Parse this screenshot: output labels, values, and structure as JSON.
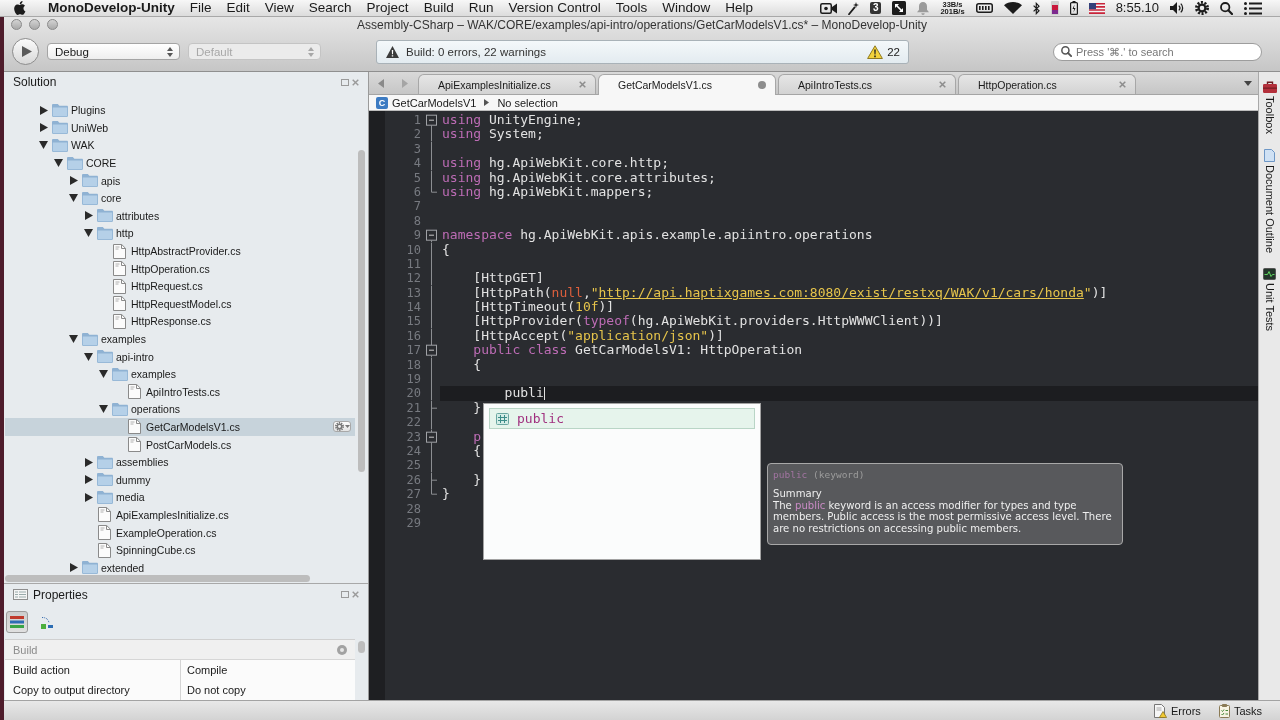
{
  "menu_bar": {
    "app_name": "MonoDevelop-Unity",
    "menus": [
      "File",
      "Edit",
      "View",
      "Search",
      "Project",
      "Build",
      "Run",
      "Version Control",
      "Tools",
      "Window",
      "Help"
    ],
    "extras_count": "3",
    "network_rates": [
      "33B/s",
      "201B/s"
    ],
    "clock": "8:55.10"
  },
  "window": {
    "title": "Assembly-CSharp – WAK/CORE/examples/api-intro/operations/GetCarModelsV1.cs* – MonoDevelop-Unity"
  },
  "toolbar": {
    "configuration": {
      "value": "Debug",
      "disabled": false
    },
    "platform": {
      "value": "Default",
      "disabled": true
    },
    "build_status": "Build: 0 errors, 22 warnings",
    "warning_count": "22",
    "search": {
      "placeholder": "Press '⌘.' to search"
    }
  },
  "solution_pad": {
    "title": "Solution",
    "tree": [
      {
        "kind": "folder",
        "label": "Plugins",
        "expanded": false,
        "selected": false
      },
      {
        "kind": "folder",
        "label": "UniWeb",
        "expanded": false,
        "selected": false
      },
      {
        "kind": "folder",
        "label": "WAK",
        "expanded": true,
        "selected": false,
        "children": [
          {
            "kind": "folder",
            "label": "CORE",
            "expanded": true,
            "selected": false,
            "children": [
              {
                "kind": "folder",
                "label": "apis",
                "expanded": false,
                "selected": false
              },
              {
                "kind": "folder",
                "label": "core",
                "expanded": true,
                "selected": false,
                "children": [
                  {
                    "kind": "folder",
                    "label": "attributes",
                    "expanded": false,
                    "selected": false
                  },
                  {
                    "kind": "folder",
                    "label": "http",
                    "expanded": true,
                    "selected": false,
                    "children": [
                      {
                        "kind": "file",
                        "label": "HttpAbstractProvider.cs",
                        "selected": false
                      },
                      {
                        "kind": "file",
                        "label": "HttpOperation.cs",
                        "selected": false
                      },
                      {
                        "kind": "file",
                        "label": "HttpRequest.cs",
                        "selected": false
                      },
                      {
                        "kind": "file",
                        "label": "HttpRequestModel.cs",
                        "selected": false
                      },
                      {
                        "kind": "file",
                        "label": "HttpResponse.cs",
                        "selected": false
                      }
                    ]
                  }
                ]
              },
              {
                "kind": "folder",
                "label": "examples",
                "expanded": true,
                "selected": false,
                "children": [
                  {
                    "kind": "folder",
                    "label": "api-intro",
                    "expanded": true,
                    "selected": false,
                    "children": [
                      {
                        "kind": "folder",
                        "label": "examples",
                        "expanded": true,
                        "selected": false,
                        "children": [
                          {
                            "kind": "file",
                            "label": "ApiIntroTests.cs",
                            "selected": false
                          }
                        ]
                      },
                      {
                        "kind": "folder",
                        "label": "operations",
                        "expanded": true,
                        "selected": false,
                        "children": [
                          {
                            "kind": "file",
                            "label": "GetCarModelsV1.cs",
                            "selected": true
                          },
                          {
                            "kind": "file",
                            "label": "PostCarModels.cs",
                            "selected": false
                          }
                        ]
                      }
                    ]
                  },
                  {
                    "kind": "folder",
                    "label": "assemblies",
                    "expanded": false,
                    "selected": false
                  },
                  {
                    "kind": "folder",
                    "label": "dummy",
                    "expanded": false,
                    "selected": false
                  },
                  {
                    "kind": "folder",
                    "label": "media",
                    "expanded": false,
                    "selected": false
                  },
                  {
                    "kind": "file",
                    "label": "ApiExamplesInitialize.cs",
                    "selected": false
                  },
                  {
                    "kind": "file",
                    "label": "ExampleOperation.cs",
                    "selected": false
                  },
                  {
                    "kind": "file",
                    "label": "SpinningCube.cs",
                    "selected": false
                  }
                ]
              },
              {
                "kind": "folder",
                "label": "extended",
                "expanded": false,
                "selected": false
              }
            ]
          }
        ]
      }
    ]
  },
  "properties_pad": {
    "title": "Properties",
    "view_buttons": [
      {
        "kind": "categorized",
        "selected": true
      },
      {
        "kind": "alphabetical",
        "selected": false
      }
    ],
    "category": "Build",
    "rows": [
      {
        "name": "Build action",
        "value": "Compile"
      },
      {
        "name": "Copy to output directory",
        "value": "Do not copy"
      }
    ]
  },
  "editor": {
    "tabs": [
      {
        "label": "ApiExamplesInitialize.cs",
        "selected": false,
        "modified": false
      },
      {
        "label": "GetCarModelsV1.cs",
        "selected": true,
        "modified": true
      },
      {
        "label": "ApiIntroTests.cs",
        "selected": false,
        "modified": false
      },
      {
        "label": "HttpOperation.cs",
        "selected": false,
        "modified": false
      }
    ],
    "breadcrumb": {
      "type_icon": "C",
      "type_name": "GetCarModelsV1",
      "member": "No selection"
    },
    "lines": [
      {
        "number": "1",
        "fold_start": true,
        "fold_end": false,
        "in_fold": false,
        "current": false,
        "tokens": [
          {
            "kind": "keyword",
            "text": "using"
          },
          {
            "kind": "plain",
            "text": " UnityEngine;"
          }
        ]
      },
      {
        "number": "2",
        "fold_start": false,
        "fold_end": false,
        "in_fold": true,
        "current": false,
        "tokens": [
          {
            "kind": "keyword",
            "text": "using"
          },
          {
            "kind": "plain",
            "text": " System;"
          }
        ]
      },
      {
        "number": "3",
        "fold_start": false,
        "fold_end": false,
        "in_fold": true,
        "current": false
      },
      {
        "number": "4",
        "fold_start": false,
        "fold_end": false,
        "in_fold": true,
        "current": false,
        "tokens": [
          {
            "kind": "keyword",
            "text": "using"
          },
          {
            "kind": "plain",
            "text": " hg.ApiWebKit.core.http;"
          }
        ]
      },
      {
        "number": "5",
        "fold_start": false,
        "fold_end": false,
        "in_fold": true,
        "current": false,
        "tokens": [
          {
            "kind": "keyword",
            "text": "using"
          },
          {
            "kind": "plain",
            "text": " hg.ApiWebKit.core.attributes;"
          }
        ]
      },
      {
        "number": "6",
        "fold_start": false,
        "fold_end": true,
        "in_fold": false,
        "current": false,
        "tokens": [
          {
            "kind": "keyword",
            "text": "using"
          },
          {
            "kind": "plain",
            "text": " hg.ApiWebKit.mappers;"
          }
        ]
      },
      {
        "number": "7",
        "fold_start": false,
        "fold_end": false,
        "in_fold": false,
        "current": false
      },
      {
        "number": "8",
        "fold_start": false,
        "fold_end": false,
        "in_fold": false,
        "current": false
      },
      {
        "number": "9",
        "fold_start": true,
        "fold_end": false,
        "in_fold": false,
        "current": false,
        "tokens": [
          {
            "kind": "keyword",
            "text": "namespace"
          },
          {
            "kind": "plain",
            "text": " hg.ApiWebKit.apis.example.apiintro.operations"
          }
        ]
      },
      {
        "number": "10",
        "fold_start": false,
        "fold_end": false,
        "in_fold": true,
        "current": false,
        "tokens": [
          {
            "kind": "plain",
            "text": "{"
          }
        ]
      },
      {
        "number": "11",
        "fold_start": false,
        "fold_end": false,
        "in_fold": true,
        "current": false
      },
      {
        "number": "12",
        "fold_start": false,
        "fold_end": false,
        "in_fold": true,
        "current": false,
        "tokens": [
          {
            "kind": "plain",
            "text": "    [HttpGET]"
          }
        ]
      },
      {
        "number": "13",
        "fold_start": false,
        "fold_end": false,
        "in_fold": true,
        "current": false,
        "tokens": [
          {
            "kind": "plain",
            "text": "    [HttpPath("
          },
          {
            "kind": "literal",
            "text": "null"
          },
          {
            "kind": "plain",
            "text": ","
          },
          {
            "kind": "string",
            "text": "\""
          },
          {
            "kind": "link",
            "text": "http://api.haptixgames.com:8080/exist/restxq/WAK/v1/cars/honda"
          },
          {
            "kind": "string",
            "text": "\""
          },
          {
            "kind": "plain",
            "text": ")]"
          }
        ]
      },
      {
        "number": "14",
        "fold_start": false,
        "fold_end": false,
        "in_fold": true,
        "current": false,
        "tokens": [
          {
            "kind": "plain",
            "text": "    [HttpTimeout("
          },
          {
            "kind": "number",
            "text": "10f"
          },
          {
            "kind": "plain",
            "text": ")]"
          }
        ]
      },
      {
        "number": "15",
        "fold_start": false,
        "fold_end": false,
        "in_fold": true,
        "current": false,
        "tokens": [
          {
            "kind": "plain",
            "text": "    [HttpProvider("
          },
          {
            "kind": "keyword",
            "text": "typeof"
          },
          {
            "kind": "plain",
            "text": "(hg.ApiWebKit.providers.HttpWWWClient))]"
          }
        ]
      },
      {
        "number": "16",
        "fold_start": false,
        "fold_end": false,
        "in_fold": true,
        "current": false,
        "tokens": [
          {
            "kind": "plain",
            "text": "    [HttpAccept("
          },
          {
            "kind": "string",
            "text": "\"application/json\""
          },
          {
            "kind": "plain",
            "text": ")]"
          }
        ]
      },
      {
        "number": "17",
        "fold_start": true,
        "fold_end": false,
        "in_fold": true,
        "current": false,
        "tokens": [
          {
            "kind": "keyword",
            "text": "    public"
          },
          {
            "kind": "keyword",
            "text": " class"
          },
          {
            "kind": "plain",
            "text": " GetCarModelsV1: HttpOperation"
          }
        ]
      },
      {
        "number": "18",
        "fold_start": false,
        "fold_end": false,
        "in_fold": true,
        "current": false,
        "tokens": [
          {
            "kind": "plain",
            "text": "    {"
          }
        ]
      },
      {
        "number": "19",
        "fold_start": false,
        "fold_end": false,
        "in_fold": true,
        "current": false
      },
      {
        "number": "20",
        "fold_start": false,
        "fold_end": false,
        "in_fold": true,
        "current": true,
        "tokens": [
          {
            "kind": "plain",
            "text": "        publi"
          }
        ]
      },
      {
        "number": "21",
        "fold_start": false,
        "fold_end": true,
        "in_fold": true,
        "current": false,
        "tokens": [
          {
            "kind": "plain",
            "text": "    }"
          }
        ]
      },
      {
        "number": "22",
        "fold_start": false,
        "fold_end": false,
        "in_fold": true,
        "current": false
      },
      {
        "number": "23",
        "fold_start": true,
        "fold_end": false,
        "in_fold": true,
        "current": false,
        "tokens": [
          {
            "kind": "keyword",
            "text": "    p"
          }
        ]
      },
      {
        "number": "24",
        "fold_start": false,
        "fold_end": false,
        "in_fold": true,
        "current": false,
        "tokens": [
          {
            "kind": "plain",
            "text": "    {"
          }
        ]
      },
      {
        "number": "25",
        "fold_start": false,
        "fold_end": false,
        "in_fold": true,
        "current": false
      },
      {
        "number": "26",
        "fold_start": false,
        "fold_end": true,
        "in_fold": true,
        "current": false,
        "tokens": [
          {
            "kind": "plain",
            "text": "    }"
          }
        ]
      },
      {
        "number": "27",
        "fold_start": false,
        "fold_end": true,
        "in_fold": false,
        "current": false,
        "tokens": [
          {
            "kind": "plain",
            "text": "}"
          }
        ]
      },
      {
        "number": "28",
        "fold_start": false,
        "fold_end": false,
        "in_fold": false,
        "current": false
      },
      {
        "number": "29",
        "fold_start": false,
        "fold_end": false,
        "in_fold": false,
        "current": false
      }
    ],
    "completion": {
      "items": [
        {
          "label": "public",
          "selected": true
        }
      ]
    },
    "tooltip": {
      "heading": [
        {
          "kind": "keyword",
          "text": "public"
        },
        {
          "kind": "plain",
          "text": " (keyword)"
        }
      ],
      "section": "Summary",
      "body": [
        {
          "kind": "plain",
          "text": "The "
        },
        {
          "kind": "keyword",
          "text": "public"
        },
        {
          "kind": "plain",
          "text": " keyword is an access modifier for types and type members. Public access is the most permissive access level. There are no restrictions on accessing public members."
        }
      ]
    }
  },
  "side_tabs": [
    {
      "kind": "toolbox",
      "label": "Toolbox"
    },
    {
      "kind": "outline",
      "label": "Document Outline"
    },
    {
      "kind": "tests",
      "label": "Unit Tests"
    }
  ],
  "status_bar": {
    "pads": [
      {
        "kind": "errors",
        "label": "Errors"
      },
      {
        "kind": "tasks",
        "label": "Tasks"
      }
    ]
  }
}
